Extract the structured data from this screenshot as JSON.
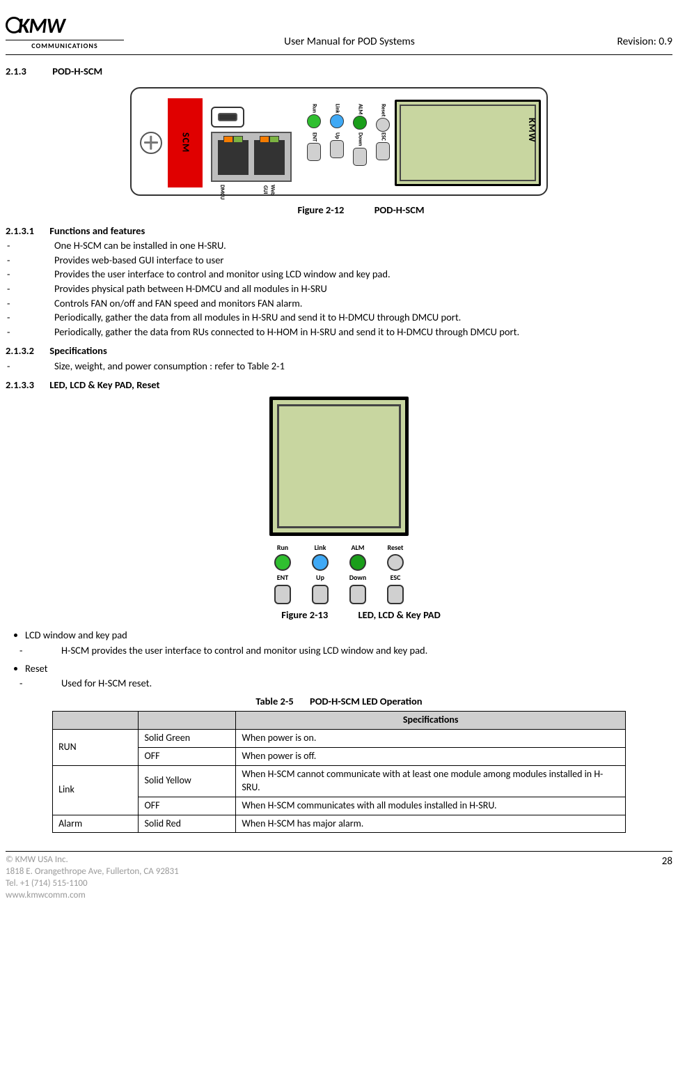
{
  "header": {
    "logo_main": "KMW",
    "logo_sub": "COMMUNICATIONS",
    "center": "User Manual for POD Systems",
    "right": "Revision: 0.9"
  },
  "section": {
    "num_213": "2.1.3",
    "title_213": "POD-H-SCM",
    "num_2131": "2.1.3.1",
    "title_2131": "Functions and features",
    "num_2132": "2.1.3.2",
    "title_2132": "Specifications",
    "num_2133": "2.1.3.3",
    "title_2133": "LED, LCD & Key PAD, Reset"
  },
  "fig212": {
    "label": "Figure 2-12",
    "title": "POD-H-SCM"
  },
  "fig213": {
    "label": "Figure 2-13",
    "title": "LED, LCD & Key PAD"
  },
  "scm": {
    "scm": "SCM",
    "dmcu": "DMCU",
    "webgui": "Web GUI",
    "kmw": "KMW",
    "run": "Run",
    "link": "Link",
    "alm": "ALM",
    "reset": "Reset",
    "ent": "ENT",
    "up": "Up",
    "down": "Down",
    "esc": "ESC"
  },
  "features": [
    "One H-SCM can be installed in one H-SRU.",
    "Provides web-based GUI interface to user",
    "Provides the user interface to control and monitor using LCD window and key pad.",
    "Provides physical path between H-DMCU and all modules in H-SRU",
    "Controls FAN on/off and FAN speed and monitors FAN alarm.",
    "Periodically, gather the data from all modules in H-SRU and send it to H-DMCU through DMCU port.",
    "Periodically, gather the data from RUs connected to H-HOM in H-SRU and send it to H-DMCU through DMCU port."
  ],
  "specs_bullet": "Size, weight, and power consumption : refer to Table 2-1",
  "lcd_bullets": {
    "b1": "LCD window and key pad",
    "b1s": "H-SCM provides the user interface to control and monitor using LCD window and key pad.",
    "b2": "Reset",
    "b2s": "Used for H-SCM reset."
  },
  "table": {
    "label": "Table 2-5",
    "title": "POD-H-SCM LED Operation",
    "header_spec": "Specifications",
    "rows": {
      "r0c0": "RUN",
      "r0c1": "Solid Green",
      "r0c2": "When power is on.",
      "r1c1": "OFF",
      "r1c2": "When power is off.",
      "r2c0": "Link",
      "r2c1": "Solid Yellow",
      "r2c2": "When H-SCM cannot communicate with at least one module among modules installed in H-SRU.",
      "r3c1": "OFF",
      "r3c2": "When H-SCM communicates with all modules installed in H-SRU.",
      "r4c0": "Alarm",
      "r4c1": "Solid Red",
      "r4c2": "When H-SCM has major alarm."
    }
  },
  "footer": {
    "l1": "© KMW USA Inc.",
    "l2": "1818 E. Orangethrope Ave, Fullerton, CA 92831",
    "l3": "Tel. +1 (714) 515-1100",
    "l4": "www.kmwcomm.com",
    "page": "28"
  }
}
